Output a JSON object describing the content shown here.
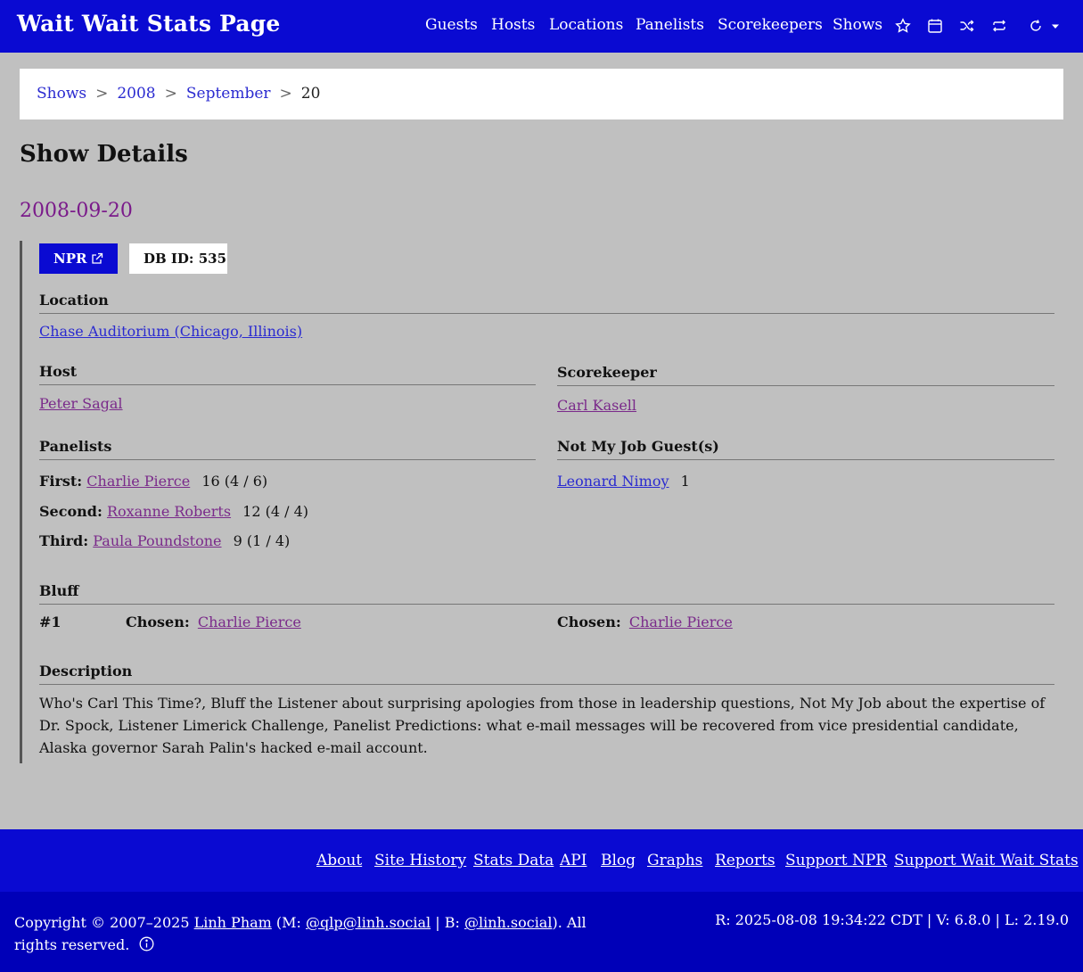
{
  "navbar": {
    "brand": "Wait Wait Stats Page",
    "links": [
      "Guests",
      "Hosts",
      "Locations",
      "Panelists",
      "Scorekeepers",
      "Shows"
    ],
    "icons": [
      "star-icon",
      "calendar-icon",
      "shuffle-icon",
      "repeat-icon"
    ],
    "theme_icon": "theme-toggle-icon"
  },
  "breadcrumb": {
    "shows": "Shows",
    "year": "2008",
    "month": "September",
    "day": "20",
    "separator": ">"
  },
  "page_title": "Show Details",
  "show": {
    "date": "2008-09-20",
    "npr_label": "NPR",
    "db_id": "DB ID: 535",
    "location_heading": "Location",
    "location": "Chase Auditorium (Chicago, Illinois)",
    "host_heading": "Host",
    "host": "Peter Sagal",
    "scorekeeper_heading": "Scorekeeper",
    "scorekeeper": "Carl Kasell",
    "panelists_heading": "Panelists",
    "panelists": [
      {
        "rank": "First:",
        "name": "Charlie Pierce",
        "score": "16 (4 / 6)"
      },
      {
        "rank": "Second:",
        "name": "Roxanne Roberts",
        "score": "12 (4 / 4)"
      },
      {
        "rank": "Third:",
        "name": "Paula Poundstone",
        "score": "9 (1 / 4)"
      }
    ],
    "guests_heading": "Not My Job Guest(s)",
    "guest": {
      "name": "Leonard Nimoy",
      "score": "1"
    },
    "bluff_heading": "Bluff",
    "bluff": {
      "number": "#1",
      "chosen_label": "Chosen:",
      "chosen": "Charlie Pierce",
      "correct_label": "Chosen:",
      "correct": "Charlie Pierce"
    },
    "description_heading": "Description",
    "description": "Who's Carl This Time?, Bluff the Listener about surprising apologies from those in leadership questions, Not My Job about the expertise of Dr. Spock, Listener Limerick Challenge, Panelist Predictions: what e-mail messages will be recovered from vice presidential candidate, Alaska governor Sarah Palin's hacked e-mail account."
  },
  "footer": {
    "links": [
      "About",
      "Site History",
      "Stats Data",
      "API",
      "Blog",
      "Graphs",
      "Reports",
      "Support NPR",
      "Support Wait Wait Stats"
    ],
    "copyright_prefix": "Copyright © 2007–2025",
    "author": "Linh Pham",
    "mastodon_prefix": "(M:",
    "mastodon": "@qlp@linh.social",
    "bluesky_prefix": "| B:",
    "bluesky": "@linh.social",
    "suffix": "). All rights reserved.",
    "revision": "R: 2025-08-08 19:34:22 CDT | V: 6.8.0 | L: 2.19.0"
  }
}
